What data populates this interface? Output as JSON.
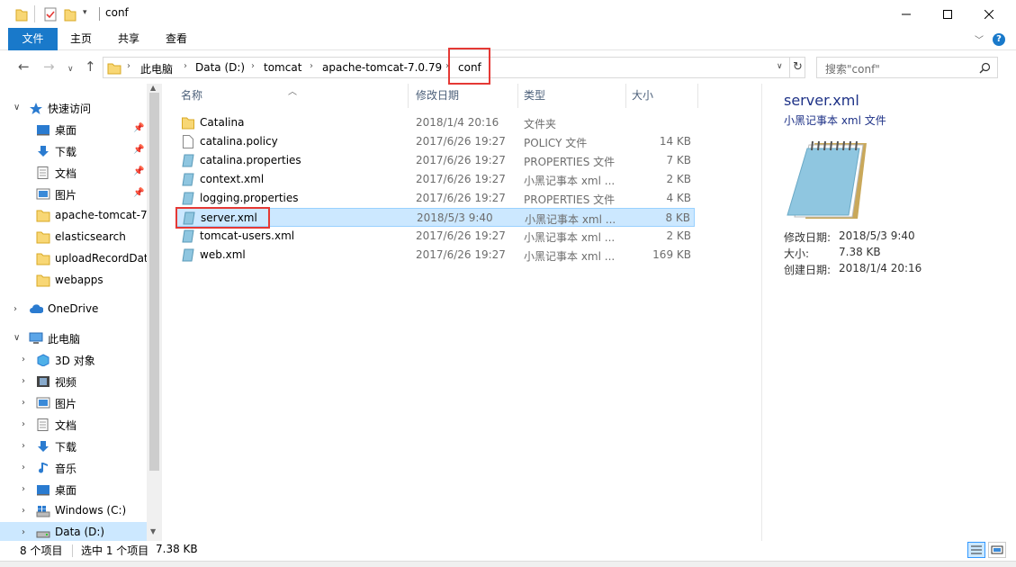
{
  "window": {
    "title": "conf"
  },
  "ribbon": {
    "tabs": [
      "文件",
      "主页",
      "共享",
      "查看"
    ]
  },
  "address": {
    "crumbs": [
      "此电脑",
      "Data (D:)",
      "tomcat",
      "apache-tomcat-7.0.79",
      "conf"
    ],
    "search_placeholder": "搜索\"conf\""
  },
  "nav": {
    "quick_access": "快速访问",
    "quick_items": [
      "桌面",
      "下载",
      "文档",
      "图片",
      "apache-tomcat-7.",
      "elasticsearch",
      "uploadRecordDat",
      "webapps"
    ],
    "onedrive": "OneDrive",
    "this_pc": "此电脑",
    "pc_items": [
      "3D 对象",
      "视频",
      "图片",
      "文档",
      "下载",
      "音乐",
      "桌面",
      "Windows (C:)",
      "Data (D:)"
    ]
  },
  "columns": {
    "name": "名称",
    "date": "修改日期",
    "type": "类型",
    "size": "大小"
  },
  "files": [
    {
      "name": "Catalina",
      "date": "2018/1/4 20:16",
      "type": "文件夹",
      "size": "",
      "icon": "folder-icon"
    },
    {
      "name": "catalina.policy",
      "date": "2017/6/26 19:27",
      "type": "POLICY 文件",
      "size": "14 KB",
      "icon": "blank-file-icon"
    },
    {
      "name": "catalina.properties",
      "date": "2017/6/26 19:27",
      "type": "PROPERTIES 文件",
      "size": "7 KB",
      "icon": "notepad-icon"
    },
    {
      "name": "context.xml",
      "date": "2017/6/26 19:27",
      "type": "小黑记事本 xml ...",
      "size": "2 KB",
      "icon": "notepad-icon"
    },
    {
      "name": "logging.properties",
      "date": "2017/6/26 19:27",
      "type": "PROPERTIES 文件",
      "size": "4 KB",
      "icon": "notepad-icon"
    },
    {
      "name": "server.xml",
      "date": "2018/5/3 9:40",
      "type": "小黑记事本 xml ...",
      "size": "8 KB",
      "icon": "notepad-icon"
    },
    {
      "name": "tomcat-users.xml",
      "date": "2017/6/26 19:27",
      "type": "小黑记事本 xml ...",
      "size": "2 KB",
      "icon": "notepad-icon"
    },
    {
      "name": "web.xml",
      "date": "2017/6/26 19:27",
      "type": "小黑记事本 xml ...",
      "size": "169 KB",
      "icon": "notepad-icon"
    }
  ],
  "preview": {
    "title": "server.xml",
    "subtitle": "小黑记事本 xml 文件",
    "modified_label": "修改日期:",
    "modified_value": "2018/5/3 9:40",
    "size_label": "大小:",
    "size_value": "7.38 KB",
    "created_label": "创建日期:",
    "created_value": "2018/1/4 20:16"
  },
  "status": {
    "count": "8 个项目",
    "selected": "选中 1 个项目",
    "selected_size": "7.38 KB"
  },
  "colors": {
    "accent": "#1979ca",
    "selection": "#cce8ff",
    "highlight_box": "#e53935"
  }
}
